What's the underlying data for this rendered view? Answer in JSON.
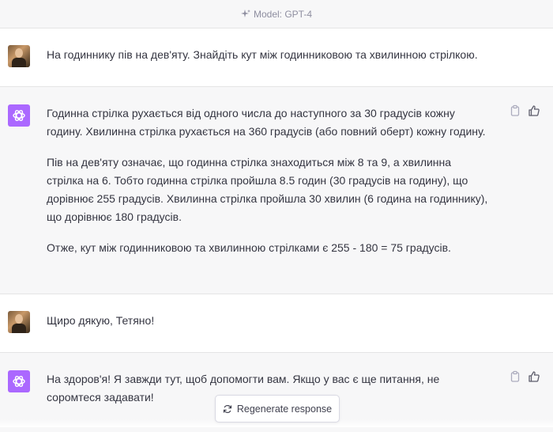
{
  "header": {
    "model_label": "Model: GPT-4"
  },
  "messages": [
    {
      "role": "user",
      "paragraphs": [
        "На годиннику пів на дев'яту. Знайдіть кут між годинниковою та хвилинною стрілкою."
      ]
    },
    {
      "role": "assistant",
      "paragraphs": [
        "Годинна стрілка рухається від одного числа до наступного за 30 градусів кожну годину. Хвилинна стрілка рухається на 360 градусів (або повний оберт) кожну годину.",
        "Пів на дев'яту означає, що годинна стрілка знаходиться між 8 та 9, а хвилинна стрілка на 6. Тобто годинна стрілка пройшла 8.5 годин (30 градусів на годину), що дорівнює 255 градусів. Хвилинна стрілка пройшла 30 хвилин (6 година на годиннику), що дорівнює 180 градусів.",
        "Отже, кут між годинниковою та хвилинною стрілками є 255 - 180 = 75 градусів."
      ]
    },
    {
      "role": "user",
      "paragraphs": [
        "Щиро дякую, Тетяно!"
      ]
    },
    {
      "role": "assistant",
      "paragraphs": [
        "На здоров'я! Я завжди тут, щоб допомогти вам. Якщо у вас є ще питання, не соромтеся задавати!"
      ]
    }
  ],
  "regenerate": {
    "label": "Regenerate response"
  },
  "colors": {
    "assistant_avatar": "#ab68ff",
    "assistant_bg": "#f7f7f8"
  },
  "icons": {
    "copy": "clipboard-icon",
    "like": "thumbs-up-icon",
    "model": "sparkle-icon",
    "regen": "refresh-icon"
  }
}
